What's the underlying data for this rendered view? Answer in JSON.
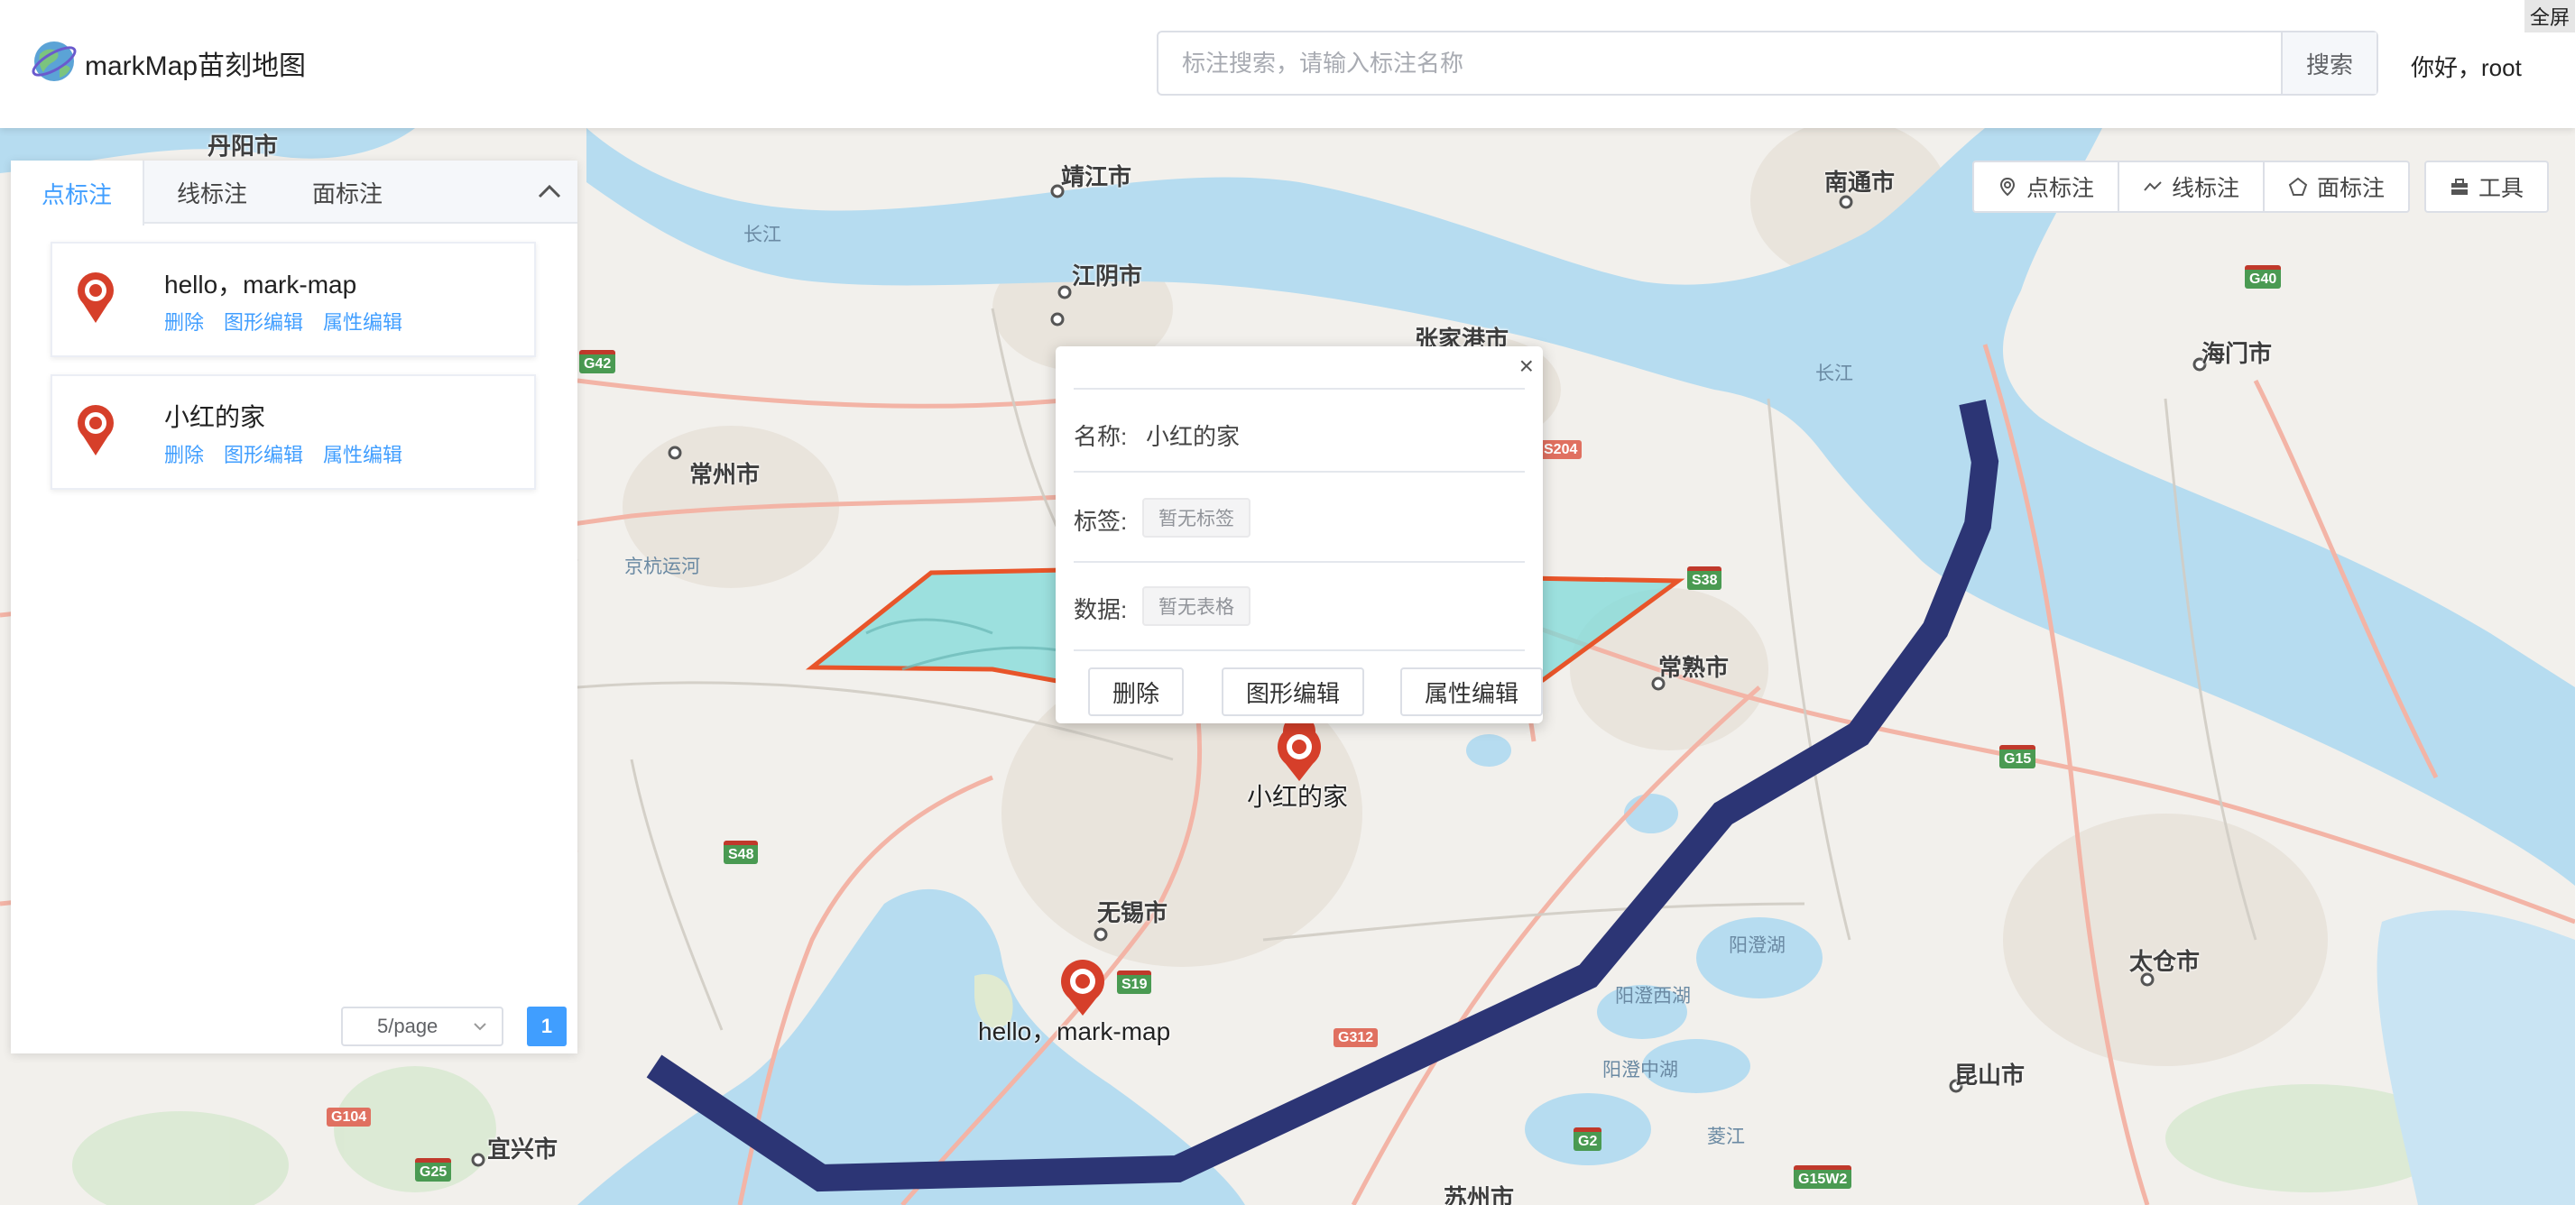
{
  "header": {
    "app_title": "markMap苗刻地图",
    "search_placeholder": "标注搜索，请输入标注名称",
    "search_button": "搜索",
    "greeting": "你好，root",
    "fullscreen": "全屏"
  },
  "panel": {
    "tabs": [
      {
        "label": "点标注",
        "active": true
      },
      {
        "label": "线标注",
        "active": false
      },
      {
        "label": "面标注",
        "active": false
      }
    ],
    "items": [
      {
        "title": "hello，mark-map",
        "actions": [
          "删除",
          "图形编辑",
          "属性编辑"
        ]
      },
      {
        "title": "小红的家",
        "actions": [
          "删除",
          "图形编辑",
          "属性编辑"
        ]
      }
    ],
    "pagination": {
      "page_size": "5/page",
      "current_page": "1"
    }
  },
  "toolbar": {
    "point": "点标注",
    "line": "线标注",
    "area": "面标注",
    "tools": "工具"
  },
  "popup": {
    "name_label": "名称:",
    "name_value": "小红的家",
    "tags_label": "标签:",
    "tags_value": "暂无标签",
    "data_label": "数据:",
    "data_value": "暂无表格",
    "delete_button": "删除",
    "shape_edit_button": "图形编辑",
    "attr_edit_button": "属性编辑",
    "close_icon": "×"
  },
  "map": {
    "markers": [
      {
        "label": "小红的家"
      },
      {
        "label": "hello，mark-map"
      }
    ],
    "cities": [
      "丹阳市",
      "靖江市",
      "江阴市",
      "张家港市",
      "南通市",
      "海门市",
      "常州市",
      "常熟市",
      "无锡市",
      "太仓市",
      "昆山市",
      "宜兴市",
      "苏州市"
    ],
    "water_labels": [
      "长江",
      "长江",
      "京杭运河",
      "阳澄湖",
      "阳澄西湖",
      "阳澄中湖",
      "菱江"
    ],
    "road_shields": [
      "G42",
      "S38",
      "G40",
      "G15",
      "S48",
      "S19",
      "G312",
      "G104",
      "G25",
      "G2",
      "G15W2",
      "S204"
    ],
    "polygon_color": "#7fdbd9",
    "polygon_stroke": "#e8552a",
    "line_color": "#2c3575",
    "marker_color": "#d63f2a"
  }
}
